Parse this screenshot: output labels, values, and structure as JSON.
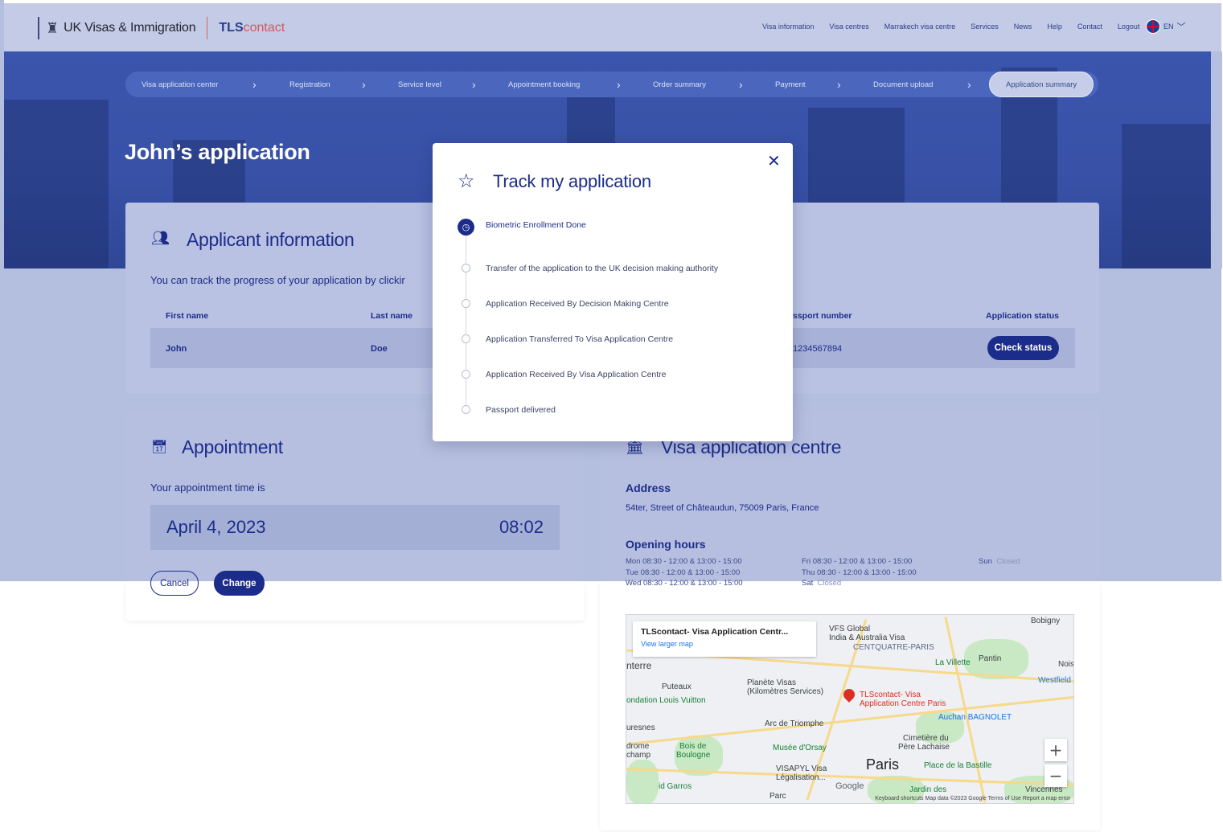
{
  "header": {
    "brand_uk": "UK Visas & Immigration",
    "brand_tls": "TLS",
    "brand_tls_suffix": "contact",
    "nav": [
      "Visa information",
      "Visa centres",
      "Marrakech visa centre",
      "Services",
      "News",
      "Help",
      "Contact",
      "Logout"
    ],
    "language": "EN"
  },
  "stepper": {
    "steps": [
      "Visa application center",
      "Registration",
      "Service level",
      "Appointment booking",
      "Order summary",
      "Payment",
      "Document upload",
      "Application summary"
    ],
    "active_step": "Application summary"
  },
  "page_title": "John’s application",
  "applicant": {
    "heading": "Applicant information",
    "intro": "You can track the progress of your application by clickir",
    "columns": {
      "first_name": "First name",
      "last_name": "Last name",
      "passport": "ssport number",
      "status": "Application status"
    },
    "row": {
      "first_name": "John",
      "last_name": "Doe",
      "passport": "1234567894"
    },
    "check_status_label": "Check status"
  },
  "appointment": {
    "heading": "Appointment",
    "intro": "Your appointment time is",
    "date": "April 4, 2023",
    "time": "08:02",
    "cancel_label": "Cancel",
    "change_label": "Change"
  },
  "vac": {
    "heading": "Visa application centre",
    "address_label": "Address",
    "address": "54ter, Street of Châteaudun, 75009 Paris, France",
    "hours_label": "Opening hours",
    "hours": {
      "mon": "Mon 08:30 - 12:00 & 13:00 - 15:00",
      "tue": "Tue  08:30 - 12:00 & 13:00 - 15:00",
      "wed": "Wed 08:30 - 12:00 & 13:00 - 15:00",
      "fri": "Fri   08:30 - 12:00 & 13:00 - 15:00",
      "thu": "Thu  08:30 - 12:00 & 13:00 - 15:00",
      "sat_day": "Sat",
      "sat_val": "Closed",
      "sun_day": "Sun",
      "sun_val": "Closed"
    }
  },
  "map": {
    "infobox_title": "TLScontact- Visa Application Centr...",
    "infobox_link": "View larger map",
    "labels": {
      "bobigny": "Bobigny",
      "vfs": "VFS Global",
      "vfs2": "India & Australia Visa",
      "centquatre": "CENTQUATRE-PARIS",
      "villette": "La Villette",
      "pantin": "Pantin",
      "nois": "Nois",
      "westfield": "Westfield",
      "terre": "nterre",
      "puteaux": "Puteaux",
      "planete": "Planète Visas",
      "planete2": "(Kilomètres Services)",
      "tls": "TLScontact- Visa",
      "tls2": "Application Centre Paris",
      "vuitton": "ondation Louis Vuitton",
      "bagnolet": "Auchan BAGNOLET",
      "arc": "Arc de Triomphe",
      "uresnes": "uresnes",
      "bois": "Bois de",
      "bois2": "Boulogne",
      "orsay": "Musée d'Orsay",
      "cimetiere": "Cimetière du",
      "cimetiere2": "Père Lachaise",
      "paris": "Paris",
      "bastille": "Place de la Bastille",
      "drome": "drome",
      "champ": "champ",
      "visapyl": "VISAPYL Visa",
      "visapyl2": "Légalisation...",
      "garros": "id Garros",
      "google": "Google",
      "jardin": "Jardin des",
      "vincennes": "Vincennes",
      "parc": "Parc"
    },
    "footer": "Keyboard shortcuts    Map data ©2023 Google    Terms of Use    Report a map error"
  },
  "modal": {
    "title": "Track my application",
    "steps": [
      "Biometric Enrollment Done",
      "Transfer of the application to the UK decision making authority",
      "Application Received By Decision Making Centre",
      "Application Transferred To Visa Application Centre",
      "Application Received By Visa Application Centre",
      "Passport delivered"
    ]
  }
}
